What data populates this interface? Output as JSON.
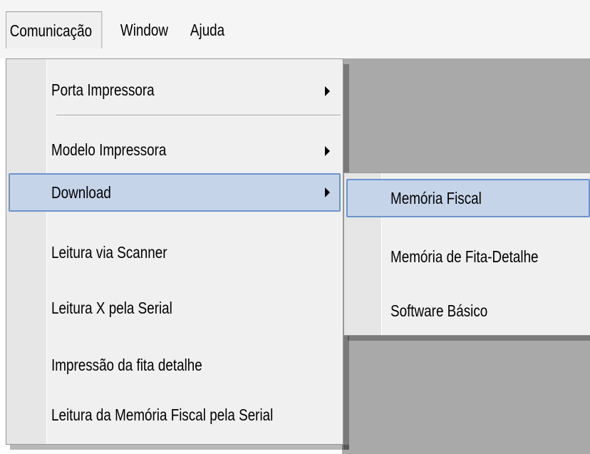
{
  "menubar": {
    "items": [
      {
        "label": "Comunicação"
      },
      {
        "label": "Window"
      },
      {
        "label": "Ajuda"
      }
    ]
  },
  "menu": {
    "items": [
      {
        "label": "Porta Impressora"
      },
      {
        "label": "Modelo Impressora"
      },
      {
        "label": "Download"
      },
      {
        "label": "Leitura via Scanner"
      },
      {
        "label": "Leitura X pela Serial"
      },
      {
        "label": "Impressão da fita detalhe"
      },
      {
        "label": "Leitura da Memória Fiscal pela Serial"
      }
    ]
  },
  "submenu": {
    "items": [
      {
        "label": "Memória Fiscal"
      },
      {
        "label": "Memória de Fita-Detalhe"
      },
      {
        "label": "Software Básico"
      }
    ]
  },
  "colors": {
    "highlight_fill": "#c6d4ea",
    "highlight_border": "#6c93cf",
    "menu_background": "#f0f0f0",
    "workspace": "#a9a9a9"
  }
}
